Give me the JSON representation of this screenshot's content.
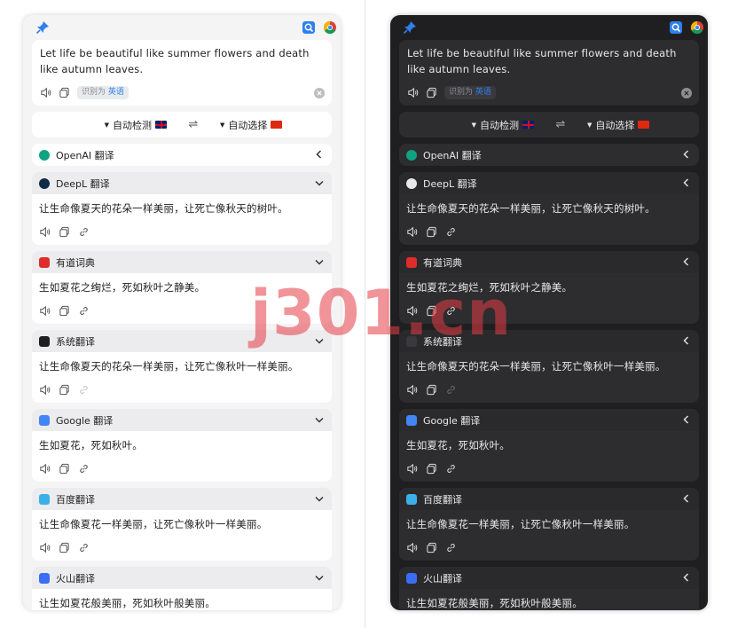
{
  "source": {
    "text": "Let life be beautiful like summer flowers and death like autumn leaves.",
    "detected_prefix": "识别为",
    "detected_lang": "英语"
  },
  "lang_bar": {
    "from": "自动检测",
    "to": "自动选择",
    "from_flag": "uk-flag-icon",
    "to_flag": "china-flag-icon",
    "swap_icon": "⇌"
  },
  "translators": [
    {
      "name": "OpenAI 翻译",
      "result": null,
      "expanded": false
    },
    {
      "name": "DeepL 翻译",
      "result": "让生命像夏天的花朵一样美丽，让死亡像秋天的树叶。",
      "expanded": true
    },
    {
      "name": "有道词典",
      "result": "生如夏花之绚烂，死如秋叶之静美。",
      "expanded": true
    },
    {
      "name": "系统翻译",
      "result": "让生命像夏天的花朵一样美丽，让死亡像秋叶一样美丽。",
      "expanded": true
    },
    {
      "name": "Google 翻译",
      "result": "生如夏花，死如秋叶。",
      "expanded": true
    },
    {
      "name": "百度翻译",
      "result": "让生命像夏花一样美丽，让死亡像秋叶一样美丽。",
      "expanded": true
    },
    {
      "name": "火山翻译",
      "result": "让生如夏花般美丽，死如秋叶般美丽。",
      "expanded": true
    }
  ],
  "colors": {
    "accent": "#2f80ed",
    "light_bg": "#f4f4f5",
    "dark_bg": "#1f1f21",
    "openai": "#10a37f",
    "deepl": "#0f2b46",
    "youdao": "#e02b2b",
    "system": "#1e1e1e",
    "google": "#4285f4",
    "baidu": "#3bb0e8",
    "volc": "#3a6cf4"
  },
  "watermark": "j301.cn"
}
